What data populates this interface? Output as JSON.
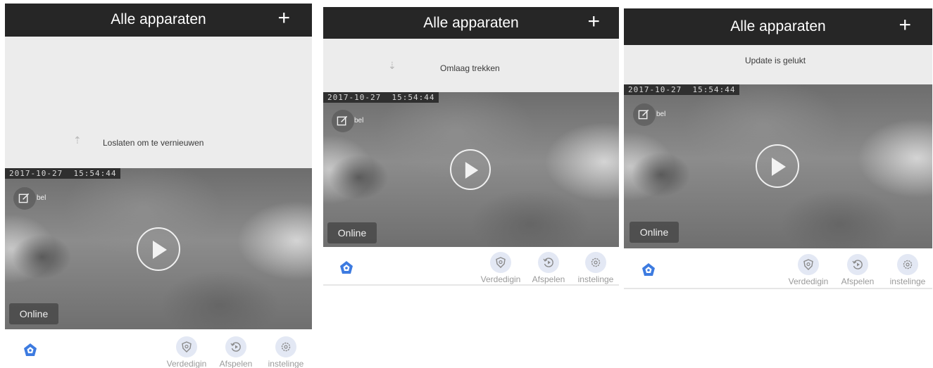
{
  "header": {
    "title": "Alle apparaten",
    "add_label": "+"
  },
  "refresh": {
    "release_text": "Loslaten om te vernieuwen",
    "pull_text": "Omlaag trekken",
    "success_text": "Update is gelukt"
  },
  "device": {
    "timestamp": "2017-10-27  15:54:44",
    "name": "bel",
    "status": "Online"
  },
  "tabs": [
    {
      "label": "Verdedigin",
      "icon": "shield-icon"
    },
    {
      "label": "Afspelen",
      "icon": "replay-icon"
    },
    {
      "label": "instelinge",
      "icon": "gear-icon"
    }
  ],
  "colors": {
    "header_bg": "#262626",
    "accent": "#3d7be0",
    "tab_circle": "#e3e8f4",
    "refresh_bg": "#ececec"
  }
}
